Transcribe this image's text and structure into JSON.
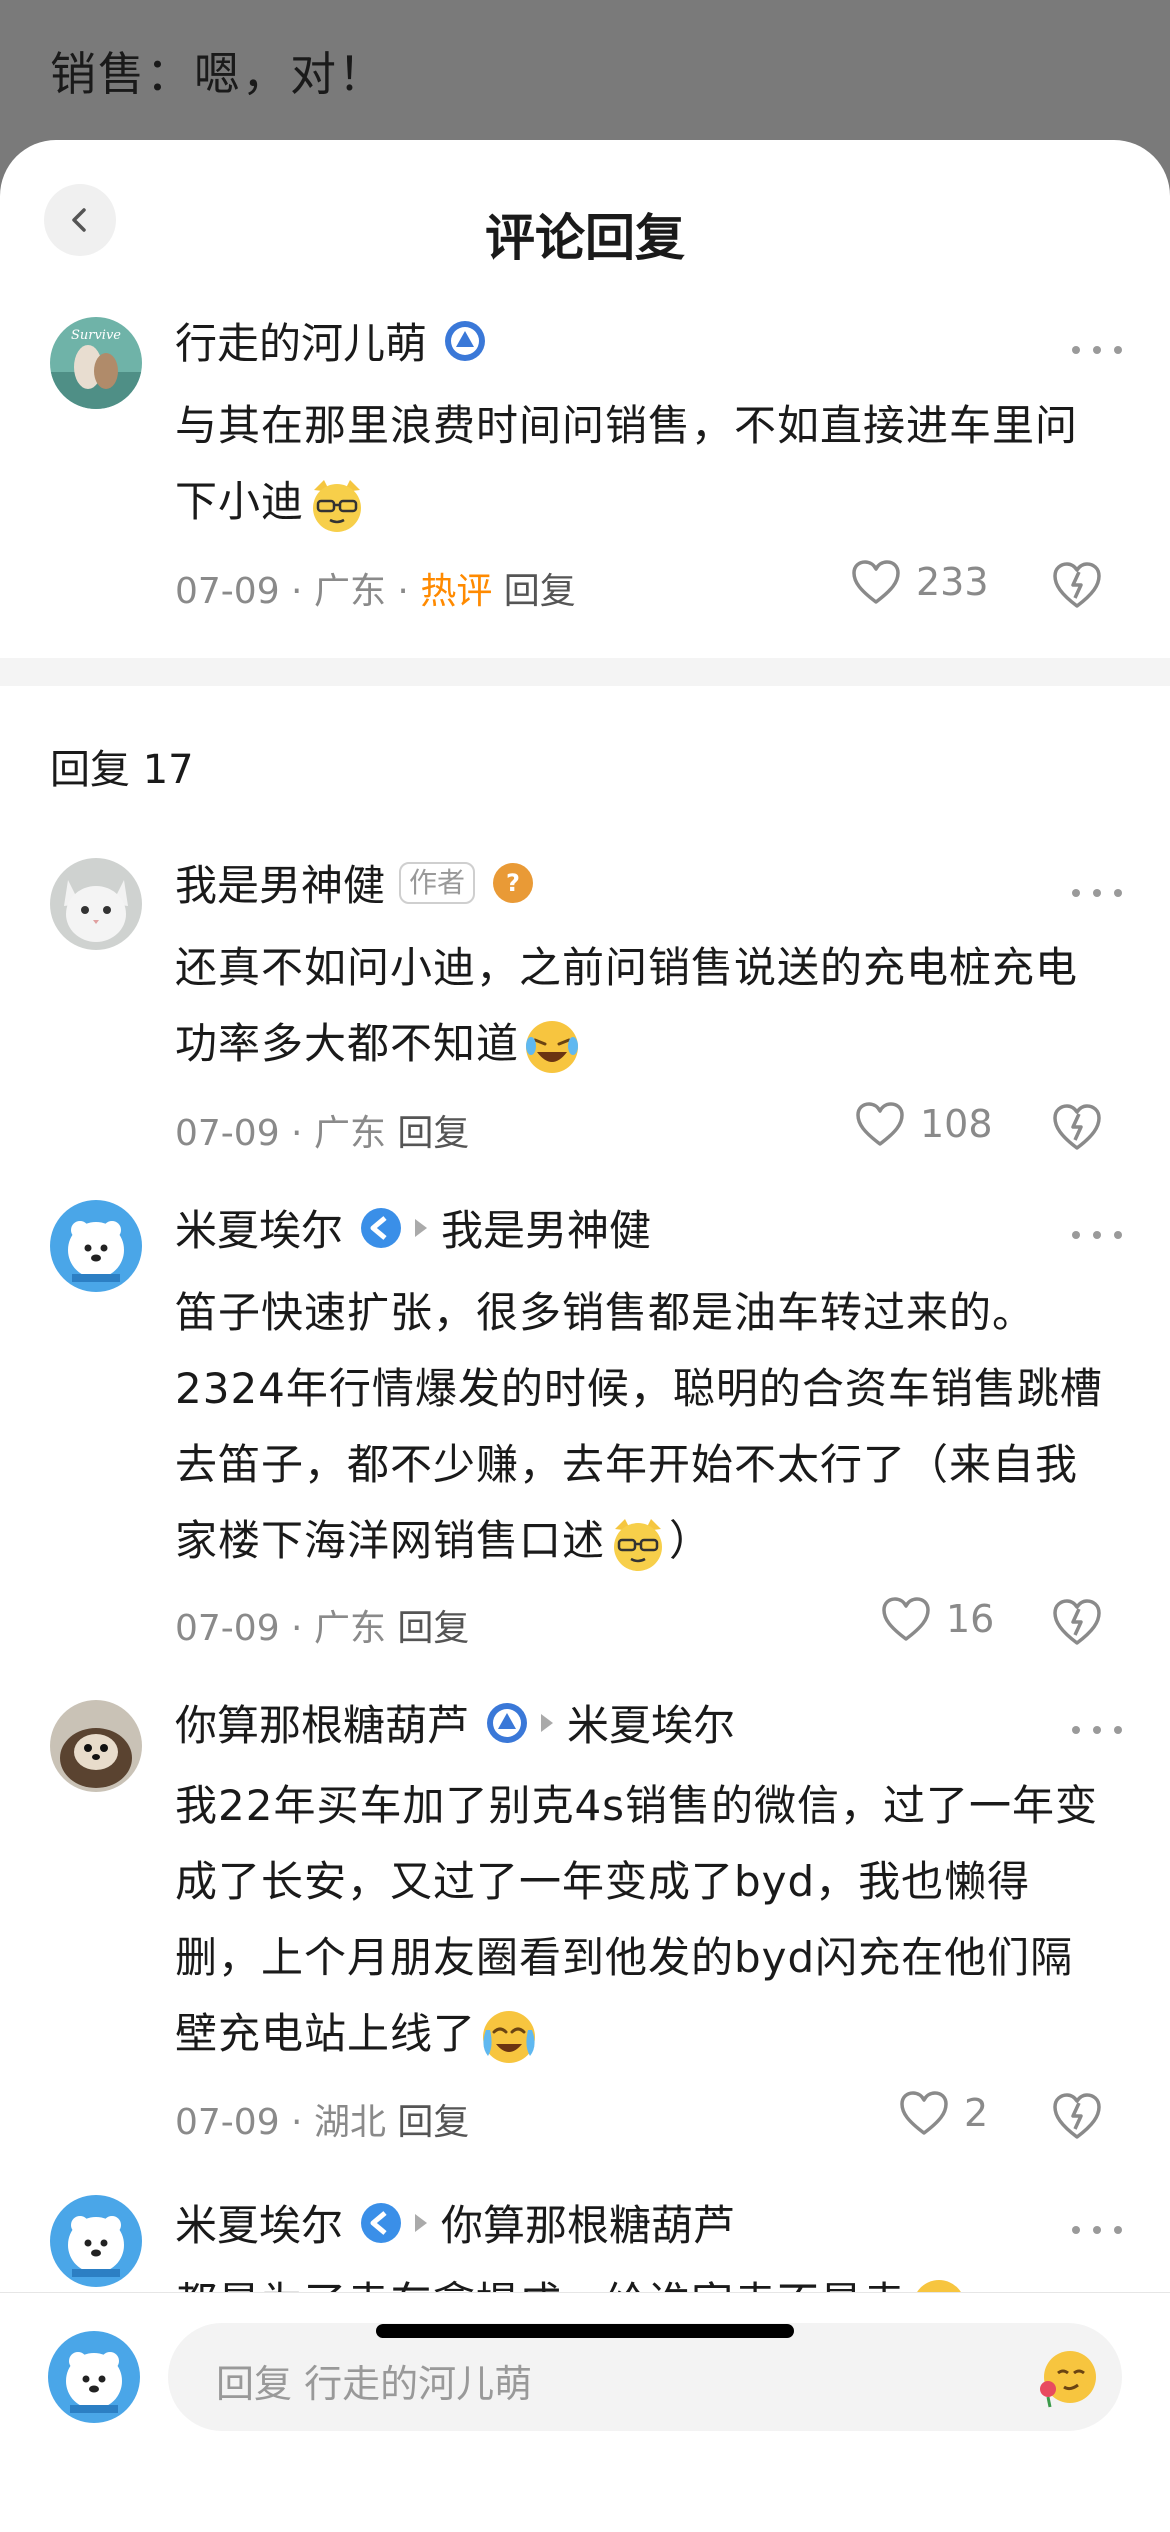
{
  "background_text": "销售：嗯，对！",
  "header": {
    "title": "评论回复"
  },
  "main_comment": {
    "user": "行走的河儿萌",
    "text": "与其在那里浪费时间问销售，不如直接进车里问下小迪",
    "date": "07-09",
    "region": "广东",
    "hot": "热评",
    "reply": "回复",
    "likes": "233"
  },
  "replies_header": "回复 17",
  "replies": [
    {
      "user": "我是男神健",
      "tag": "作者",
      "text": "还真不如问小迪，之前问销售说送的充电桩充电功率多大都不知道",
      "date": "07-09",
      "region": "广东",
      "reply": "回复",
      "likes": "108"
    },
    {
      "user": "米夏埃尔",
      "reply_to": "我是男神健",
      "text": "笛子快速扩张，很多销售都是油车转过来的。2324年行情爆发的时候，聪明的合资车销售跳槽去笛子，都不少赚，去年开始不太行了（来自我家楼下海洋网销售口述",
      "text_end": "）",
      "date": "07-09",
      "region": "广东",
      "reply": "回复",
      "likes": "16"
    },
    {
      "user": "你算那根糖葫芦",
      "reply_to": "米夏埃尔",
      "text": "我22年买车加了别克4s销售的微信，过了一年变成了长安，又过了一年变成了byd，我也懒得删，上个月朋友圈看到他发的byd闪充在他们隔壁充电站上线了",
      "date": "07-09",
      "region": "湖北",
      "reply": "回复",
      "likes": "2"
    },
    {
      "user": "米夏埃尔",
      "reply_to": "你算那根糖葫芦",
      "text": "都是为了卖车拿提成，给谁家卖不是卖"
    }
  ],
  "input": {
    "placeholder": "回复 行走的河儿萌"
  },
  "colors": {
    "hot": "#ff8a00",
    "text": "#1a1a1a",
    "meta": "#8a8a8a"
  }
}
